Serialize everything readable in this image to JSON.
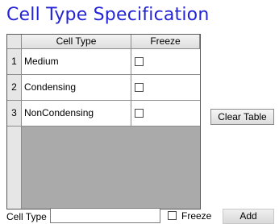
{
  "title": "Cell Type Specification",
  "table": {
    "columns": [
      "Cell Type",
      "Freeze"
    ],
    "rows": [
      {
        "num": "1",
        "cell_type": "Medium",
        "freeze": false
      },
      {
        "num": "2",
        "cell_type": "Condensing",
        "freeze": false
      },
      {
        "num": "3",
        "cell_type": "NonCondensing",
        "freeze": false
      }
    ]
  },
  "buttons": {
    "clear_table": "Clear Table",
    "add": "Add"
  },
  "form": {
    "cell_type_label": "Cell Type",
    "cell_type_value": "",
    "freeze_label": "Freeze",
    "freeze_checked": false
  }
}
